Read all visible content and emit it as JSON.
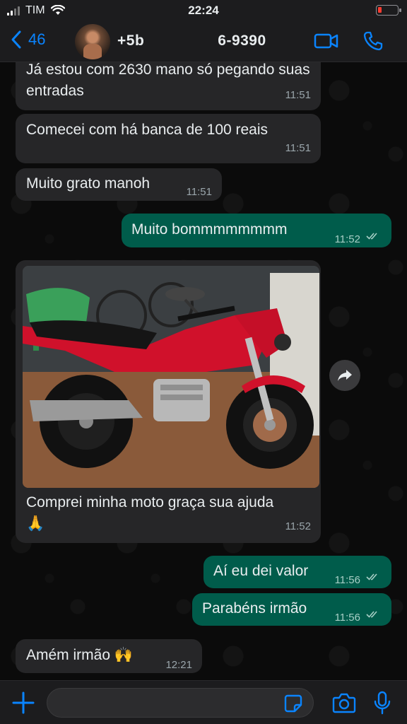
{
  "status_bar": {
    "carrier": "TIM",
    "time": "22:24"
  },
  "header": {
    "back_count": "46",
    "contact_name": "+5b",
    "contact_name_tail": "6-9390"
  },
  "messages": [
    {
      "dir": "in",
      "text": "Já estou com 2630 mano só pegando suas entradas",
      "time": "11:51"
    },
    {
      "dir": "in",
      "text": "Comecei com há banca de 100 reais",
      "time": "11:51"
    },
    {
      "dir": "in",
      "text": "Muito grato manoh",
      "time": "11:51"
    },
    {
      "dir": "out",
      "text": "Muito bommmmmmmm",
      "time": "11:52",
      "read": true
    },
    {
      "dir": "in",
      "image": "red-honda-motorcycle-photo",
      "caption": "Comprei minha moto graça sua ajuda",
      "caption_emoji": "🙏",
      "time": "11:52"
    },
    {
      "dir": "out",
      "text": "Aí eu dei valor",
      "time": "11:56",
      "read": true
    },
    {
      "dir": "out",
      "text": "Parabéns irmão",
      "time": "11:56",
      "read": true
    },
    {
      "dir": "in",
      "text": "Amém irmão",
      "emoji": "🙌",
      "time": "12:21"
    }
  ],
  "input": {
    "placeholder": ""
  },
  "colors": {
    "accent": "#0a84ff",
    "outgoing": "#005c4b",
    "incoming": "#262628",
    "read_ticks": "#53bdeb"
  },
  "icons": [
    "back-chevron-icon",
    "video-call-icon",
    "phone-call-icon",
    "forward-icon",
    "plus-icon",
    "sticker-icon",
    "camera-icon",
    "microphone-icon"
  ]
}
